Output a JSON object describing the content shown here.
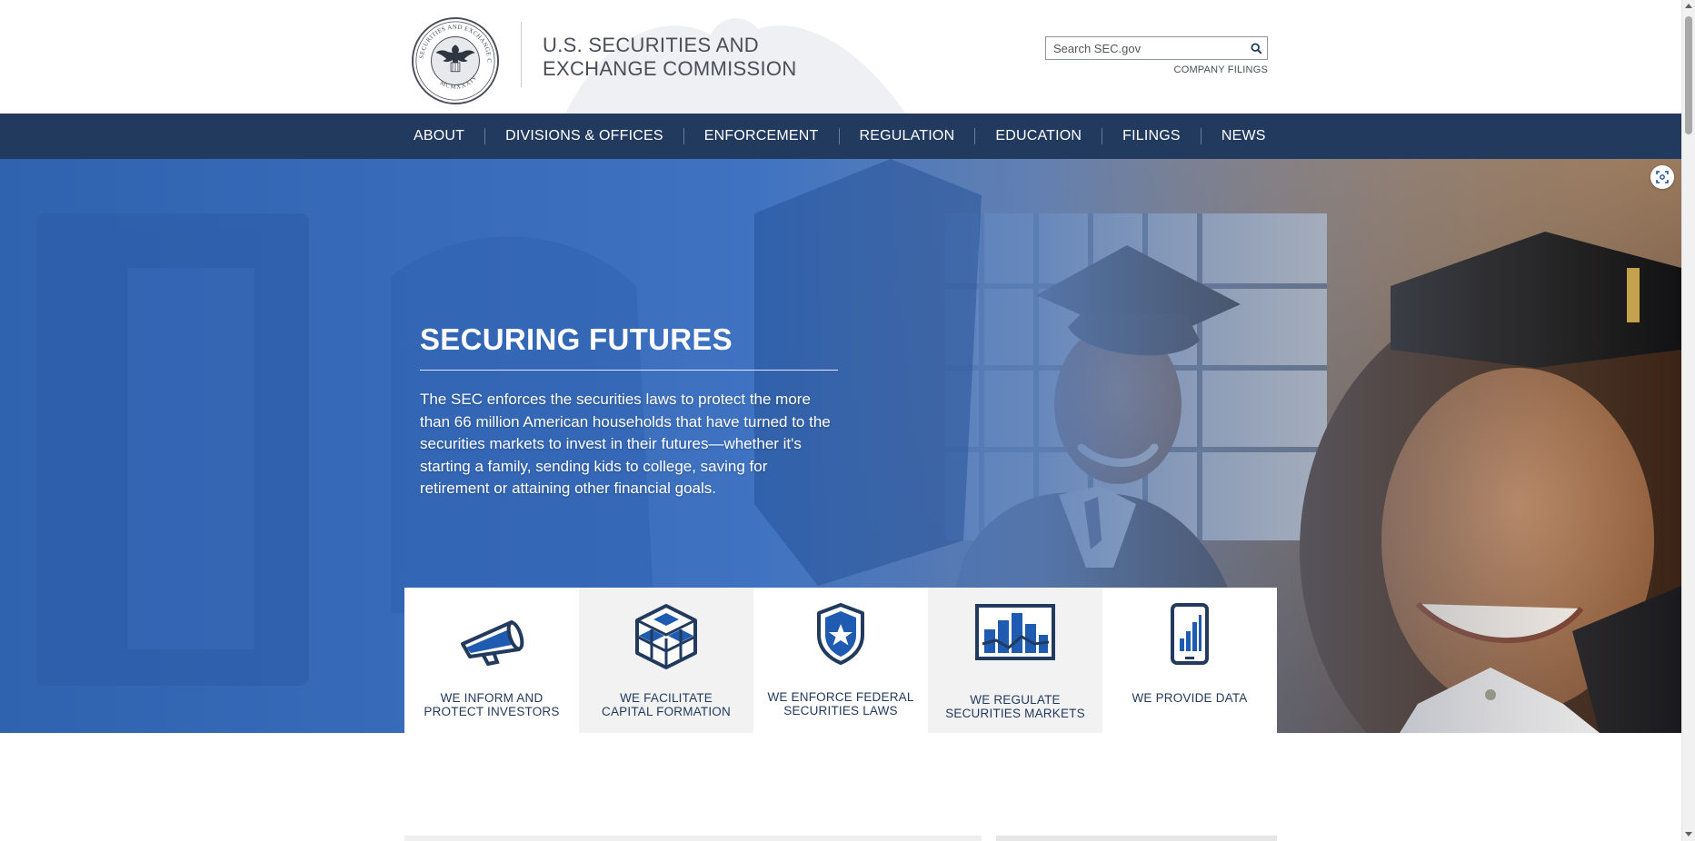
{
  "header": {
    "brand_line1": "U.S. SECURITIES AND",
    "brand_line2": "EXCHANGE COMMISSION",
    "seal_text_top": "SECURITIES AND EXCHANGE COMMISSION",
    "seal_text_bottom": "MCMXXXIV",
    "search_placeholder": "Search SEC.gov",
    "company_filings_label": "COMPANY FILINGS"
  },
  "nav": {
    "items": [
      "ABOUT",
      "DIVISIONS & OFFICES",
      "ENFORCEMENT",
      "REGULATION",
      "EDUCATION",
      "FILINGS",
      "NEWS"
    ]
  },
  "hero": {
    "title": "SECURING FUTURES",
    "text": "The SEC enforces the securities laws to protect the more than 66 million American households that have turned to the securities markets to invest in their futures—whether it's starting a family, sending kids to college, saving for retirement or attaining other financial goals."
  },
  "tiles": [
    {
      "line1": "WE INFORM AND",
      "line2": "PROTECT INVESTORS",
      "icon": "megaphone-icon"
    },
    {
      "line1": "WE FACILITATE",
      "line2": "CAPITAL FORMATION",
      "icon": "cubes-icon"
    },
    {
      "line1": "WE ENFORCE FEDERAL",
      "line2": "SECURITIES LAWS",
      "icon": "badge-shield-icon"
    },
    {
      "line1": "WE REGULATE",
      "line2": "SECURITIES MARKETS",
      "icon": "market-chart-icon"
    },
    {
      "line1": "WE PROVIDE DATA",
      "line2": "",
      "icon": "tablet-data-icon"
    }
  ],
  "colors": {
    "navy": "#223a5e",
    "hero_blue": "#3a6fbf",
    "icon_blue": "#1f4f9c"
  }
}
